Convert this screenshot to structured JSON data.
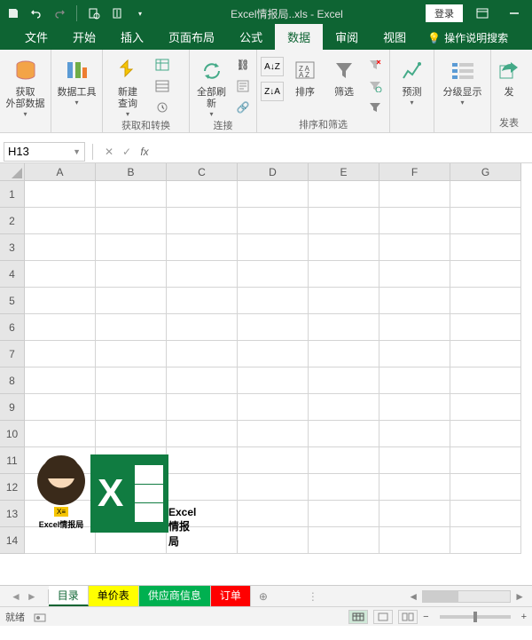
{
  "title": "Excel情报局..xls - Excel",
  "login": "登录",
  "tabs": [
    "文件",
    "开始",
    "插入",
    "页面布局",
    "公式",
    "数据",
    "审阅",
    "视图"
  ],
  "active_tab": "数据",
  "tell_me": "操作说明搜索",
  "ribbon": {
    "g1": {
      "btn": "获取\n外部数据",
      "label": ""
    },
    "g2": {
      "btn": "数据工具",
      "label": ""
    },
    "g3": {
      "btn1": "新建\n查询",
      "btn2": "全部刷新",
      "label": "获取和转换",
      "label2": "连接"
    },
    "g4": {
      "sort": "排序",
      "filter": "筛选",
      "label": "排序和筛选"
    },
    "g5": {
      "btn": "预测",
      "label": ""
    },
    "g6": {
      "btn": "分级显示",
      "label": ""
    },
    "g7": {
      "btn": "发",
      "label": "发表"
    }
  },
  "name_box": "H13",
  "columns": [
    "A",
    "B",
    "C",
    "D",
    "E",
    "F",
    "G"
  ],
  "rows": [
    "1",
    "2",
    "3",
    "4",
    "5",
    "6",
    "7",
    "8",
    "9",
    "10",
    "11",
    "12",
    "13",
    "14"
  ],
  "brand": "Excel情报局",
  "sheets": [
    {
      "name": "目录",
      "color": "active"
    },
    {
      "name": "单价表",
      "color": "yellow"
    },
    {
      "name": "供应商信息",
      "color": "green"
    },
    {
      "name": "订单",
      "color": "red"
    }
  ],
  "status": "就绪",
  "zoom_minus": "−",
  "zoom_plus": "+"
}
